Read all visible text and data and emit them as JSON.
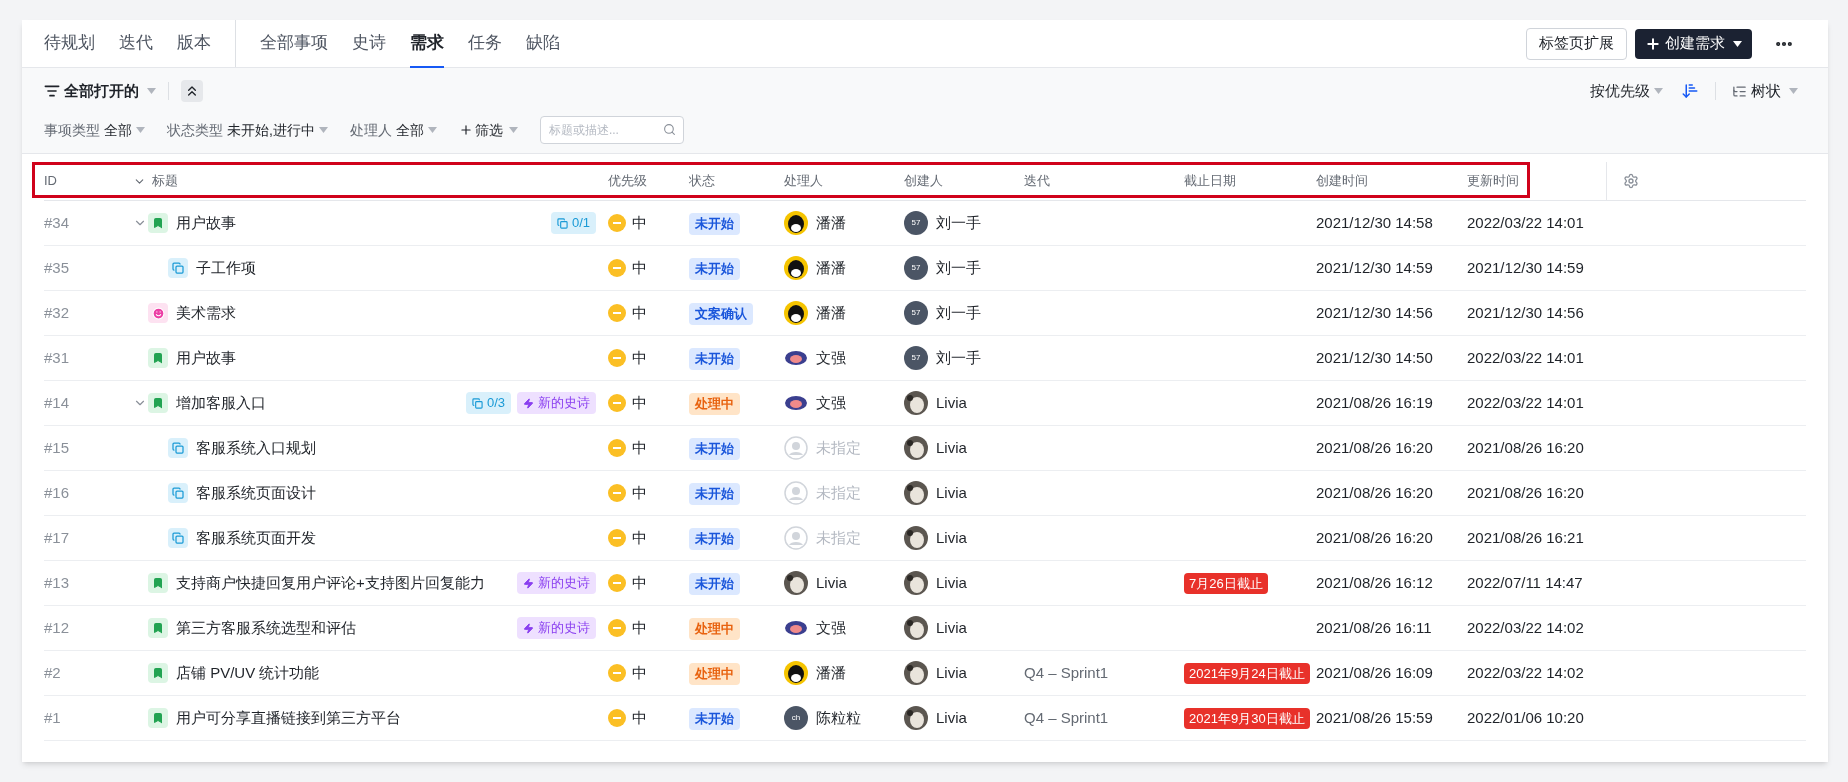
{
  "tab_groups": [
    {
      "tabs": [
        {
          "label": "待规划",
          "selected": false
        },
        {
          "label": "迭代",
          "selected": false
        },
        {
          "label": "版本",
          "selected": false
        }
      ]
    },
    {
      "tabs": [
        {
          "label": "全部事项",
          "selected": false
        },
        {
          "label": "史诗",
          "selected": false
        },
        {
          "label": "需求",
          "selected": true
        },
        {
          "label": "任务",
          "selected": false
        },
        {
          "label": "缺陷",
          "selected": false
        }
      ]
    }
  ],
  "header_actions": {
    "extension_button": "标签页扩展",
    "create_button": "创建需求"
  },
  "toolbar": {
    "view": "全部打开的",
    "sort": "按优先级",
    "layout": "树状"
  },
  "filters": [
    {
      "label": "事项类型",
      "value": "全部"
    },
    {
      "label": "状态类型",
      "value": "未开始,进行中"
    },
    {
      "label": "处理人",
      "value": "全部"
    }
  ],
  "add_filter": "筛选",
  "search": {
    "placeholder": "标题或描述..."
  },
  "columns": [
    "ID",
    "标题",
    "优先级",
    "状态",
    "处理人",
    "创建人",
    "迭代",
    "截止日期",
    "创建时间",
    "更新时间"
  ],
  "rows": [
    {
      "id": "#34",
      "expanded": true,
      "kind": "story",
      "title": "用户故事",
      "badges": [
        {
          "kind": "subtasks",
          "label": "0/1"
        }
      ],
      "priority": "中",
      "status": {
        "kind": "todo",
        "label": "未开始"
      },
      "assignee": {
        "avatar": {
          "kind": "penguin"
        },
        "name": "潘潘"
      },
      "creator": {
        "avatar": {
          "kind": "initials",
          "text": "57"
        },
        "name": "刘一手"
      },
      "created": "2021/12/30 14:58",
      "updated": "2022/03/22 14:01",
      "children": [
        {
          "id": "#35",
          "kind": "subtask",
          "title": "子工作项",
          "priority": "中",
          "status": {
            "kind": "todo",
            "label": "未开始"
          },
          "assignee": {
            "avatar": {
              "kind": "penguin"
            },
            "name": "潘潘"
          },
          "creator": {
            "avatar": {
              "kind": "initials",
              "text": "57"
            },
            "name": "刘一手"
          },
          "created": "2021/12/30 14:59",
          "updated": "2021/12/30 14:59"
        }
      ]
    },
    {
      "id": "#32",
      "kind": "art",
      "title": "美术需求",
      "priority": "中",
      "status": {
        "kind": "todo",
        "label": "文案确认"
      },
      "assignee": {
        "avatar": {
          "kind": "penguin"
        },
        "name": "潘潘"
      },
      "creator": {
        "avatar": {
          "kind": "initials",
          "text": "57"
        },
        "name": "刘一手"
      },
      "created": "2021/12/30 14:56",
      "updated": "2021/12/30 14:56"
    },
    {
      "id": "#31",
      "kind": "story",
      "title": "用户故事",
      "priority": "中",
      "status": {
        "kind": "todo",
        "label": "未开始"
      },
      "assignee": {
        "avatar": {
          "kind": "monkey"
        },
        "name": "文强"
      },
      "creator": {
        "avatar": {
          "kind": "initials",
          "text": "57"
        },
        "name": "刘一手"
      },
      "created": "2021/12/30 14:50",
      "updated": "2022/03/22 14:01"
    },
    {
      "id": "#14",
      "expanded": true,
      "kind": "story",
      "title": "增加客服入口",
      "badges": [
        {
          "kind": "subtasks",
          "label": "0/3"
        },
        {
          "kind": "epic",
          "label": "新的史诗"
        }
      ],
      "priority": "中",
      "status": {
        "kind": "doing",
        "label": "处理中"
      },
      "assignee": {
        "avatar": {
          "kind": "monkey"
        },
        "name": "文强"
      },
      "creator": {
        "avatar": {
          "kind": "photo"
        },
        "name": "Livia"
      },
      "created": "2021/08/26 16:19",
      "updated": "2022/03/22 14:01",
      "children": [
        {
          "id": "#15",
          "kind": "subtask",
          "title": "客服系统入口规划",
          "priority": "中",
          "status": {
            "kind": "todo",
            "label": "未开始"
          },
          "assignee": {
            "avatar": {
              "kind": "none"
            },
            "name": "未指定"
          },
          "creator": {
            "avatar": {
              "kind": "photo"
            },
            "name": "Livia"
          },
          "created": "2021/08/26 16:20",
          "updated": "2021/08/26 16:20"
        },
        {
          "id": "#16",
          "kind": "subtask",
          "title": "客服系统页面设计",
          "priority": "中",
          "status": {
            "kind": "todo",
            "label": "未开始"
          },
          "assignee": {
            "avatar": {
              "kind": "none"
            },
            "name": "未指定"
          },
          "creator": {
            "avatar": {
              "kind": "photo"
            },
            "name": "Livia"
          },
          "created": "2021/08/26 16:20",
          "updated": "2021/08/26 16:20"
        },
        {
          "id": "#17",
          "kind": "subtask",
          "title": "客服系统页面开发",
          "priority": "中",
          "status": {
            "kind": "todo",
            "label": "未开始"
          },
          "assignee": {
            "avatar": {
              "kind": "none"
            },
            "name": "未指定"
          },
          "creator": {
            "avatar": {
              "kind": "photo"
            },
            "name": "Livia"
          },
          "created": "2021/08/26 16:20",
          "updated": "2021/08/26 16:21"
        }
      ]
    },
    {
      "id": "#13",
      "kind": "story",
      "title": "支持商户快捷回复用户评论+支持图片回复能力",
      "badges": [
        {
          "kind": "epic",
          "label": "新的史诗"
        }
      ],
      "priority": "中",
      "status": {
        "kind": "todo",
        "label": "未开始"
      },
      "assignee": {
        "avatar": {
          "kind": "photo"
        },
        "name": "Livia"
      },
      "creator": {
        "avatar": {
          "kind": "photo"
        },
        "name": "Livia"
      },
      "deadline": "7月26日截止",
      "created": "2021/08/26 16:12",
      "updated": "2022/07/11 14:47"
    },
    {
      "id": "#12",
      "kind": "story",
      "title": "第三方客服系统选型和评估",
      "badges": [
        {
          "kind": "epic",
          "label": "新的史诗"
        }
      ],
      "priority": "中",
      "status": {
        "kind": "doing",
        "label": "处理中"
      },
      "assignee": {
        "avatar": {
          "kind": "monkey"
        },
        "name": "文强"
      },
      "creator": {
        "avatar": {
          "kind": "photo"
        },
        "name": "Livia"
      },
      "created": "2021/08/26 16:11",
      "updated": "2022/03/22 14:02"
    },
    {
      "id": "#2",
      "kind": "story",
      "title": "店铺 PV/UV 统计功能",
      "priority": "中",
      "status": {
        "kind": "doing",
        "label": "处理中"
      },
      "assignee": {
        "avatar": {
          "kind": "penguin"
        },
        "name": "潘潘"
      },
      "creator": {
        "avatar": {
          "kind": "photo"
        },
        "name": "Livia"
      },
      "iteration": "Q4 – Sprint1",
      "deadline": "2021年9月24日截止",
      "created": "2021/08/26 16:09",
      "updated": "2022/03/22 14:02"
    },
    {
      "id": "#1",
      "kind": "story",
      "title": "用户可分享直播链接到第三方平台",
      "priority": "中",
      "status": {
        "kind": "todo",
        "label": "未开始"
      },
      "assignee": {
        "avatar": {
          "kind": "initials",
          "text": "ch"
        },
        "name": "陈粒粒"
      },
      "creator": {
        "avatar": {
          "kind": "photo"
        },
        "name": "Livia"
      },
      "iteration": "Q4 – Sprint1",
      "deadline": "2021年9月30日截止",
      "created": "2021/08/26 15:59",
      "updated": "2022/01/06 10:20"
    }
  ]
}
